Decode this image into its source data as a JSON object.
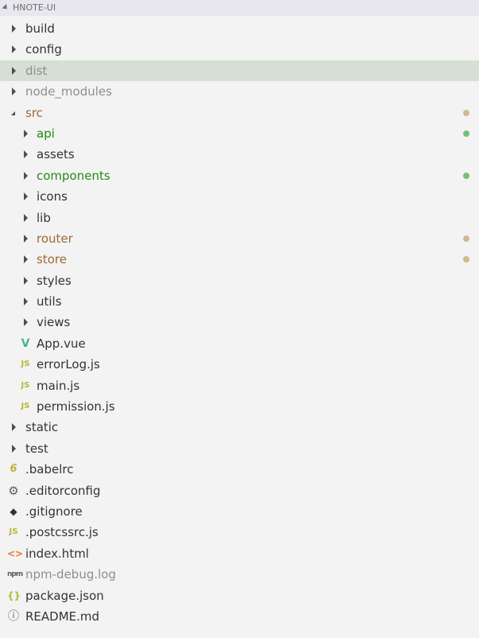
{
  "header": {
    "title": "HNOTE-UI"
  },
  "colors": {
    "default": "#333333",
    "ignored": "#8e8e8e",
    "untracked": "#238a15",
    "modified": "#9b6a33",
    "dot_untracked": "#73c07a",
    "dot_modified": "#d3b892",
    "selected_bg": "#d6dfd3"
  },
  "items": [
    {
      "label": "build",
      "depth": 0,
      "type": "folder",
      "expanded": false,
      "status": "default"
    },
    {
      "label": "config",
      "depth": 0,
      "type": "folder",
      "expanded": false,
      "status": "default"
    },
    {
      "label": "dist",
      "depth": 0,
      "type": "folder",
      "expanded": false,
      "status": "ignored",
      "selected": true
    },
    {
      "label": "node_modules",
      "depth": 0,
      "type": "folder",
      "expanded": false,
      "status": "ignored"
    },
    {
      "label": "src",
      "depth": 0,
      "type": "folder",
      "expanded": true,
      "status": "modified-parent",
      "dot": "brown"
    },
    {
      "label": "api",
      "depth": 1,
      "type": "folder",
      "expanded": false,
      "status": "untracked",
      "dot": "green"
    },
    {
      "label": "assets",
      "depth": 1,
      "type": "folder",
      "expanded": false,
      "status": "default"
    },
    {
      "label": "components",
      "depth": 1,
      "type": "folder",
      "expanded": false,
      "status": "untracked",
      "dot": "green"
    },
    {
      "label": "icons",
      "depth": 1,
      "type": "folder",
      "expanded": false,
      "status": "default"
    },
    {
      "label": "lib",
      "depth": 1,
      "type": "folder",
      "expanded": false,
      "status": "default"
    },
    {
      "label": "router",
      "depth": 1,
      "type": "folder",
      "expanded": false,
      "status": "modified",
      "dot": "brown"
    },
    {
      "label": "store",
      "depth": 1,
      "type": "folder",
      "expanded": false,
      "status": "modified",
      "dot": "brown"
    },
    {
      "label": "styles",
      "depth": 1,
      "type": "folder",
      "expanded": false,
      "status": "default"
    },
    {
      "label": "utils",
      "depth": 1,
      "type": "folder",
      "expanded": false,
      "status": "default"
    },
    {
      "label": "views",
      "depth": 1,
      "type": "folder",
      "expanded": false,
      "status": "default"
    },
    {
      "label": "App.vue",
      "depth": 1,
      "type": "file",
      "icon": "vue-icon",
      "glyph": "V",
      "status": "default"
    },
    {
      "label": "errorLog.js",
      "depth": 1,
      "type": "file",
      "icon": "js-icon",
      "glyph": "JS",
      "status": "default"
    },
    {
      "label": "main.js",
      "depth": 1,
      "type": "file",
      "icon": "js-icon",
      "glyph": "JS",
      "status": "default"
    },
    {
      "label": "permission.js",
      "depth": 1,
      "type": "file",
      "icon": "js-icon",
      "glyph": "JS",
      "status": "default"
    },
    {
      "label": "static",
      "depth": 0,
      "type": "folder",
      "expanded": false,
      "status": "default"
    },
    {
      "label": "test",
      "depth": 0,
      "type": "folder",
      "expanded": false,
      "status": "default"
    },
    {
      "label": ".babelrc",
      "depth": 0,
      "type": "file",
      "icon": "babel-icon",
      "glyph": "6",
      "status": "default"
    },
    {
      "label": ".editorconfig",
      "depth": 0,
      "type": "file",
      "icon": "gear-icon",
      "glyph": "⚙",
      "status": "default"
    },
    {
      "label": ".gitignore",
      "depth": 0,
      "type": "file",
      "icon": "git-icon",
      "glyph": "◆",
      "status": "default"
    },
    {
      "label": ".postcssrc.js",
      "depth": 0,
      "type": "file",
      "icon": "js-icon",
      "glyph": "JS",
      "status": "default"
    },
    {
      "label": "index.html",
      "depth": 0,
      "type": "file",
      "icon": "html-icon",
      "glyph": "<>",
      "status": "default"
    },
    {
      "label": "npm-debug.log",
      "depth": 0,
      "type": "file",
      "icon": "npm-icon",
      "glyph": "npm",
      "status": "ignored"
    },
    {
      "label": "package.json",
      "depth": 0,
      "type": "file",
      "icon": "json-icon",
      "glyph": "{}",
      "status": "default"
    },
    {
      "label": "README.md",
      "depth": 0,
      "type": "file",
      "icon": "info-icon",
      "glyph": "ⓘ",
      "status": "default"
    }
  ]
}
